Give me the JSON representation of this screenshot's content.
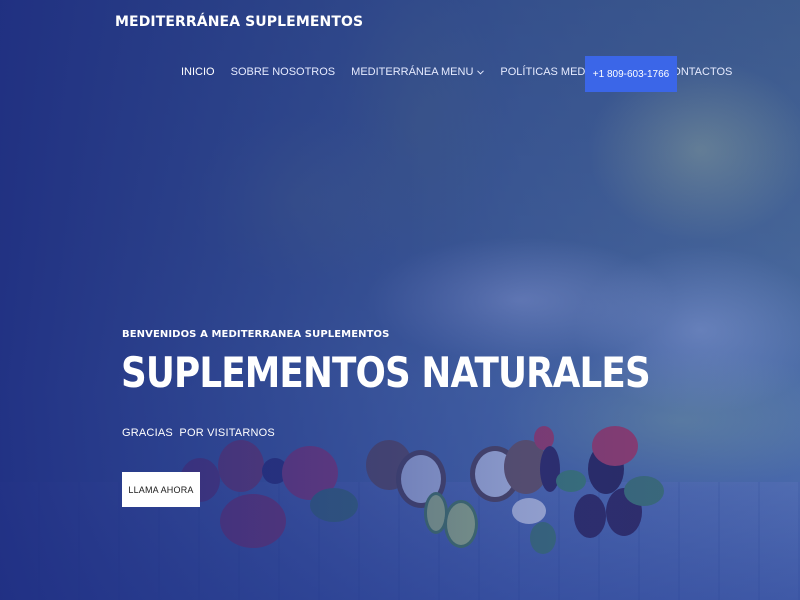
{
  "header": {
    "logo": "MEDITERRÁNEA SUPLEMENTOS"
  },
  "nav": {
    "items": [
      {
        "label": "INICIO",
        "active": true
      },
      {
        "label": "SOBRE NOSOTROS"
      },
      {
        "label": "MEDITERRÁNEA MENU",
        "has_dropdown": true
      },
      {
        "label": "POLÍTICAS MEDITERRÁNEA"
      },
      {
        "label": "CONTACTOS"
      }
    ],
    "dropdown_icon": "chevron-down-icon",
    "phone_label": "+1 809-603-1766"
  },
  "hero": {
    "eyebrow": "BENVENIDOS A MEDITERRANEA SUPLEMENTOS",
    "headline": "SUPLEMENTOS NATURALES",
    "subtitle": "GRACIAS  POR VISITARNOS",
    "cta_label": "LLAMA AHORA"
  },
  "colors": {
    "accent_button": "#3b66e8",
    "overlay": "#1e2d82"
  }
}
